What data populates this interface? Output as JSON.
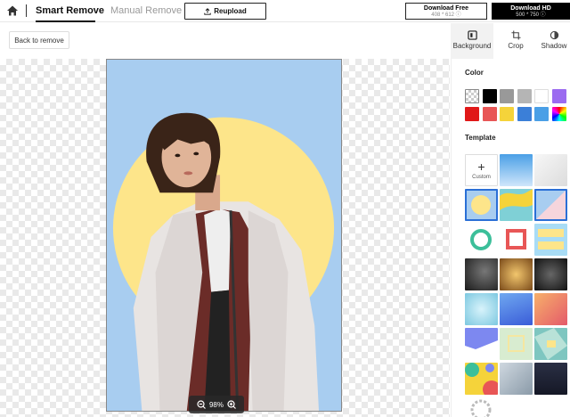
{
  "topbar": {
    "tab_smart": "Smart Remove",
    "tab_manual": "Manual Remove",
    "reupload_label": "Reupload",
    "download_free": {
      "title": "Download Free",
      "size": "408 * 612"
    },
    "download_hd": {
      "title": "Download HD",
      "size": "500 * 750"
    }
  },
  "subbar": {
    "back_label": "Back to remove",
    "tools": [
      {
        "label": "Background"
      },
      {
        "label": "Crop"
      },
      {
        "label": "Shadow"
      }
    ]
  },
  "canvas": {
    "zoom_level": "98%",
    "background_color": "#a8cdf0",
    "circle_color": "#fde58a"
  },
  "panel": {
    "color_title": "Color",
    "colors": [
      "transparent",
      "#000000",
      "#999999",
      "#b5b5b5",
      "#ffffff",
      "#9b6bf0",
      "#e01818",
      "#e85656",
      "#f5d33a",
      "#3b7fd8",
      "#4a9fe6",
      "rainbow"
    ],
    "template_title": "Template",
    "custom_label": "Custom",
    "icons": {
      "home": "home-icon",
      "upload": "upload-icon",
      "background": "background-icon",
      "crop": "crop-icon",
      "shadow": "shadow-icon",
      "zoom_out": "zoom-out-icon",
      "zoom_in": "zoom-in-icon",
      "info": "info-icon"
    }
  }
}
